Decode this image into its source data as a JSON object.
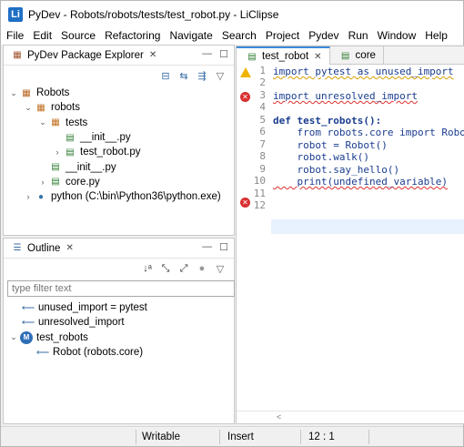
{
  "window": {
    "title": "PyDev - Robots/robots/tests/test_robot.py - LiClipse",
    "app_icon_letter": "li"
  },
  "menu": [
    "File",
    "Edit",
    "Source",
    "Refactoring",
    "Navigate",
    "Search",
    "Project",
    "Pydev",
    "Run",
    "Window",
    "Help"
  ],
  "explorer": {
    "tab_label": "PyDev Package Explorer",
    "tree": [
      {
        "label": "Robots",
        "icon": "project-icon"
      },
      {
        "label": "robots",
        "icon": "package-icon"
      },
      {
        "label": "tests",
        "icon": "package-icon"
      },
      {
        "label": "__init__.py",
        "icon": "python-file-icon"
      },
      {
        "label": "test_robot.py",
        "icon": "python-file-icon"
      },
      {
        "label": "__init__.py",
        "icon": "python-file-icon"
      },
      {
        "label": "core.py",
        "icon": "python-file-icon"
      },
      {
        "label": "python  (C:\\bin\\Python36\\python.exe)",
        "icon": "python-interpreter-icon"
      }
    ]
  },
  "outline": {
    "tab_label": "Outline",
    "filter_placeholder": "type filter text",
    "items": [
      {
        "label": "unused_import = pytest",
        "icon": "import-icon"
      },
      {
        "label": "unresolved_import",
        "icon": "import-icon"
      },
      {
        "label": "test_robots",
        "icon": "method-icon"
      },
      {
        "label": "Robot (robots.core)",
        "icon": "import-icon"
      }
    ]
  },
  "editor": {
    "tabs": [
      {
        "label": "test_robot",
        "active": true
      },
      {
        "label": "core",
        "active": false
      }
    ],
    "line_numbers": [
      "1",
      "2",
      "3",
      "4",
      "5",
      "6",
      "7",
      "8",
      "9",
      "10",
      "11",
      "12"
    ],
    "lines": [
      "import pytest as unused_import",
      "",
      "import unresolved_import",
      "",
      "def test_robots():",
      "    from robots.core import Robot",
      "    robot = Robot()",
      "    robot.walk()",
      "    robot.say_hello()",
      "    print(undefined_variable)",
      "",
      ""
    ],
    "scroll_indicator": "<"
  },
  "status": {
    "writable": "Writable",
    "insert_mode": "Insert",
    "position": "12 : 1"
  },
  "colors": {
    "error": "#d93030",
    "warning": "#f0b400",
    "keyword": "#1a3d8f",
    "current_line": "#e8f2fe"
  }
}
